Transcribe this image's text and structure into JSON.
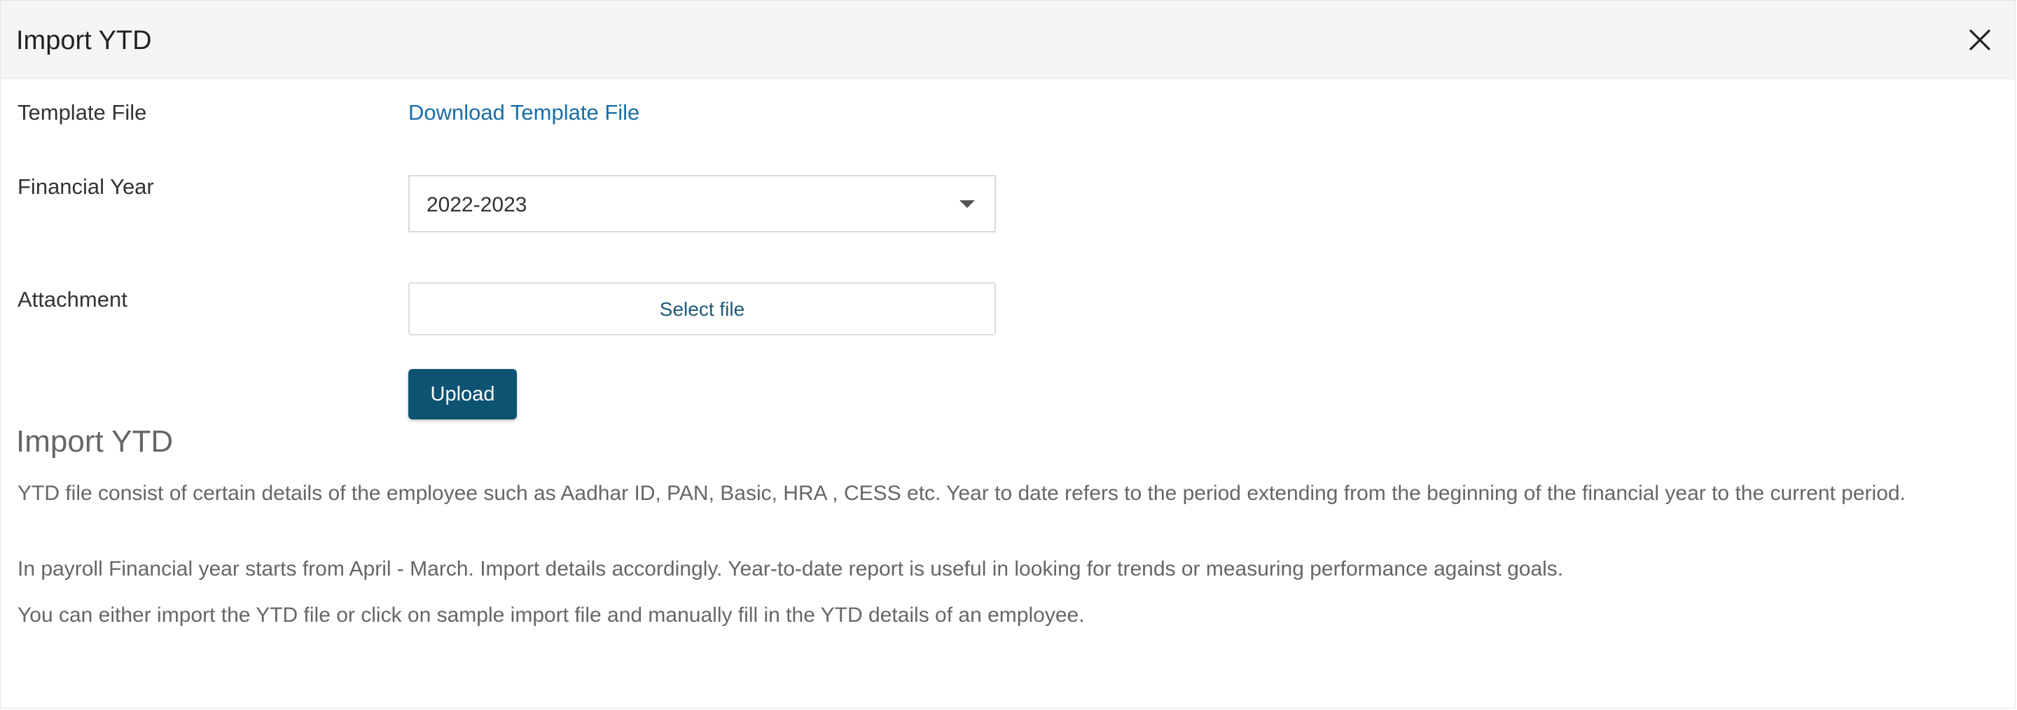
{
  "dialog": {
    "title": "Import YTD",
    "close_icon": "close-icon"
  },
  "form": {
    "template_file_label": "Template File",
    "download_link": "Download Template File",
    "financial_year_label": "Financial Year",
    "financial_year_value": "2022-2023",
    "attachment_label": "Attachment",
    "select_file_label": "Select file",
    "upload_label": "Upload"
  },
  "info": {
    "title": "Import YTD",
    "paragraphs": [
      "YTD file consist of certain details of the employee such as Aadhar ID, PAN, Basic, HRA , CESS etc. Year to date refers to the period extending from the beginning of the financial year to the current period.",
      "In payroll Financial year starts from April - March. Import details accordingly. Year-to-date report is useful in looking for trends or measuring performance against goals.",
      "You can either import the YTD file or click on sample import file and manually fill in the YTD details of an employee."
    ]
  },
  "colors": {
    "header_bg": "#f5f5f5",
    "link": "#1a6ea8",
    "primary_button": "#0e5472",
    "muted_text": "#666666"
  }
}
